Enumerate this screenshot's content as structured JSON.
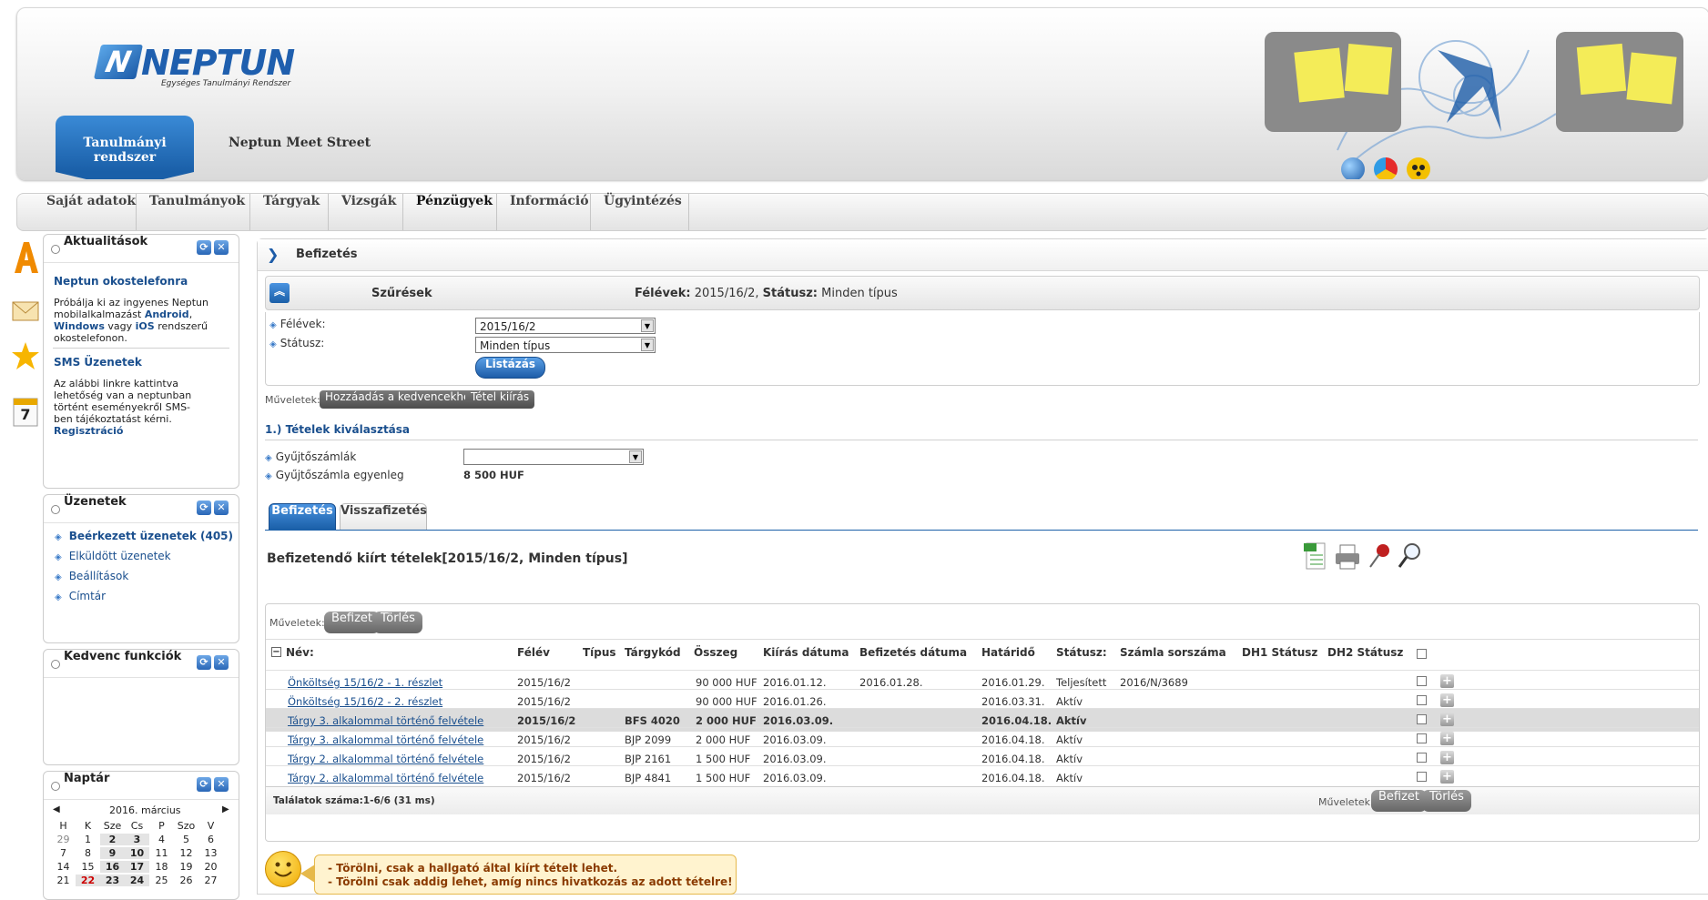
{
  "header": {
    "logo_text": "NEPTUN",
    "logo_tagline": "Egységes Tanulmányi Rendszer",
    "tab_active": "Tanulmányi rendszer",
    "tab_other": "Neptun Meet Street",
    "icons": [
      "globe-icon",
      "color-wheel-icon",
      "accessibility-icon"
    ]
  },
  "nav": {
    "items": [
      "Saját adatok",
      "Tanulmányok",
      "Tárgyak",
      "Vizsgák",
      "Pénzügyek",
      "Információ",
      "Ügyintézés"
    ],
    "active": "Pénzügyek"
  },
  "side_icons": [
    "letter-a-icon",
    "envelope-icon",
    "star-icon",
    "calendar-icon"
  ],
  "side_calendar_number": "7",
  "widgets": {
    "aktualitasok": {
      "title": "Aktualitások",
      "item1_title": "Neptun okostelefonra",
      "item1_text_a": "Próbálja ki az ingyenes Neptun mobilalkalmazást",
      "item1_link_android": "Android",
      "item1_sep": ",",
      "item1_link_windows": "Windows",
      "item1_vagy": "vagy",
      "item1_link_ios": "iOS",
      "item1_text_b": "rendszerű okostelefonon.",
      "item2_title": "SMS Üzenetek",
      "item2_text": "Az alábbi linkre kattintva lehetőség van a neptunban történt eseményekről SMS-ben tájékoztatást kérni.",
      "item2_link": "Regisztráció"
    },
    "uzenetek": {
      "title": "Üzenetek",
      "items": [
        "Beérkezett üzenetek (405)",
        "Elküldött üzenetek",
        "Beállítások",
        "Címtár"
      ]
    },
    "kedvenc": {
      "title": "Kedvenc funkciók"
    },
    "naptar": {
      "title": "Naptár",
      "month": "2016. március",
      "days": [
        "H",
        "K",
        "Sze",
        "Cs",
        "P",
        "Szo",
        "V"
      ],
      "weeks": [
        [
          "29",
          "1",
          "2",
          "3",
          "4",
          "5",
          "6"
        ],
        [
          "7",
          "8",
          "9",
          "10",
          "11",
          "12",
          "13"
        ],
        [
          "14",
          "15",
          "16",
          "17",
          "18",
          "19",
          "20"
        ],
        [
          "21",
          "22",
          "23",
          "24",
          "25",
          "26",
          "27"
        ]
      ]
    }
  },
  "main": {
    "title": "Befizetés",
    "filter": {
      "title": "Szűrések",
      "summary_label1": "Félévek:",
      "summary_value1": "2015/16/2,",
      "summary_label2": "Státusz:",
      "summary_value2": "Minden típus",
      "felevek_label": "Félévek:",
      "felevek_value": "2015/16/2",
      "statusz_label": "Státusz:",
      "statusz_value": "Minden típus",
      "list_button": "Listázás"
    },
    "muveletek_label": "Műveletek:",
    "action_fav": "Hozzáadás a kedvencekhez",
    "action_print": "Tétel kiírás",
    "section1_title": "1.) Tételek kiválasztása",
    "gyujto_label": "Gyűjtőszámlák",
    "gyujto_value": "",
    "egyenleg_label": "Gyűjtőszámla egyenleg",
    "egyenleg_value": "8 500 HUF",
    "tabs": [
      "Befizetés",
      "Visszafizetés"
    ],
    "grid_title": "Befizetendő kiírt tételek[2015/16/2, Minden típus]",
    "grid_tool_icons": [
      "xls-export-icon",
      "print-icon",
      "pin-icon",
      "search-icon"
    ],
    "grid_muveletek": "Műveletek:",
    "btn_befizet": "Befizet",
    "btn_torles": "Törlés",
    "columns": [
      "Név:",
      "Félév",
      "Típus",
      "Tárgykód",
      "Összeg",
      "Kiírás dátuma",
      "Befizetés dátuma",
      "Határidő",
      "Státusz:",
      "Számla sorszáma",
      "DH1 Státusz",
      "DH2 Státusz"
    ],
    "rows": [
      {
        "nev": "Önköltség 15/16/2 - 1. részlet",
        "felev": "2015/16/2",
        "tipus": "",
        "targykod": "",
        "osszeg": "90 000 HUF",
        "kiiras": "2016.01.12.",
        "befizetes": "2016.01.28.",
        "hatarido": "2016.01.29.",
        "statusz": "Teljesített",
        "szamla": "2016/N/3689",
        "dh1": "",
        "dh2": ""
      },
      {
        "nev": "Önköltség 15/16/2 - 2. részlet",
        "felev": "2015/16/2",
        "tipus": "",
        "targykod": "",
        "osszeg": "90 000 HUF",
        "kiiras": "2016.01.26.",
        "befizetes": "",
        "hatarido": "2016.03.31.",
        "statusz": "Aktív",
        "szamla": "",
        "dh1": "",
        "dh2": ""
      },
      {
        "nev": "Tárgy 3. alkalommal történő felvétele",
        "felev": "2015/16/2",
        "tipus": "",
        "targykod": "BFS 4020",
        "osszeg": "2 000 HUF",
        "kiiras": "2016.03.09.",
        "befizetes": "",
        "hatarido": "2016.04.18.",
        "statusz": "Aktív",
        "szamla": "",
        "dh1": "",
        "dh2": ""
      },
      {
        "nev": "Tárgy 3. alkalommal történő felvétele",
        "felev": "2015/16/2",
        "tipus": "",
        "targykod": "BJP 2099",
        "osszeg": "2 000 HUF",
        "kiiras": "2016.03.09.",
        "befizetes": "",
        "hatarido": "2016.04.18.",
        "statusz": "Aktív",
        "szamla": "",
        "dh1": "",
        "dh2": ""
      },
      {
        "nev": "Tárgy 2. alkalommal történő felvétele",
        "felev": "2015/16/2",
        "tipus": "",
        "targykod": "BJP 2161",
        "osszeg": "1 500 HUF",
        "kiiras": "2016.03.09.",
        "befizetes": "",
        "hatarido": "2016.04.18.",
        "statusz": "Aktív",
        "szamla": "",
        "dh1": "",
        "dh2": ""
      },
      {
        "nev": "Tárgy 2. alkalommal történő felvétele",
        "felev": "2015/16/2",
        "tipus": "",
        "targykod": "BJP 4841",
        "osszeg": "1 500 HUF",
        "kiiras": "2016.03.09.",
        "befizetes": "",
        "hatarido": "2016.04.18.",
        "statusz": "Aktív",
        "szamla": "",
        "dh1": "",
        "dh2": ""
      }
    ],
    "highlighted_row": 2,
    "talalatok": "Találatok száma:1-6/6 (31 ms)",
    "tip_line1": "- Törölni, csak a hallgató által kiírt tételt lehet.",
    "tip_line2": "- Törölni csak addig lehet, amíg nincs hivatkozás az adott tételre!"
  },
  "colors": {
    "brand_blue": "#1a5fa8",
    "link_blue": "#1a4f8e",
    "tip_bg": "#fff3cf"
  }
}
